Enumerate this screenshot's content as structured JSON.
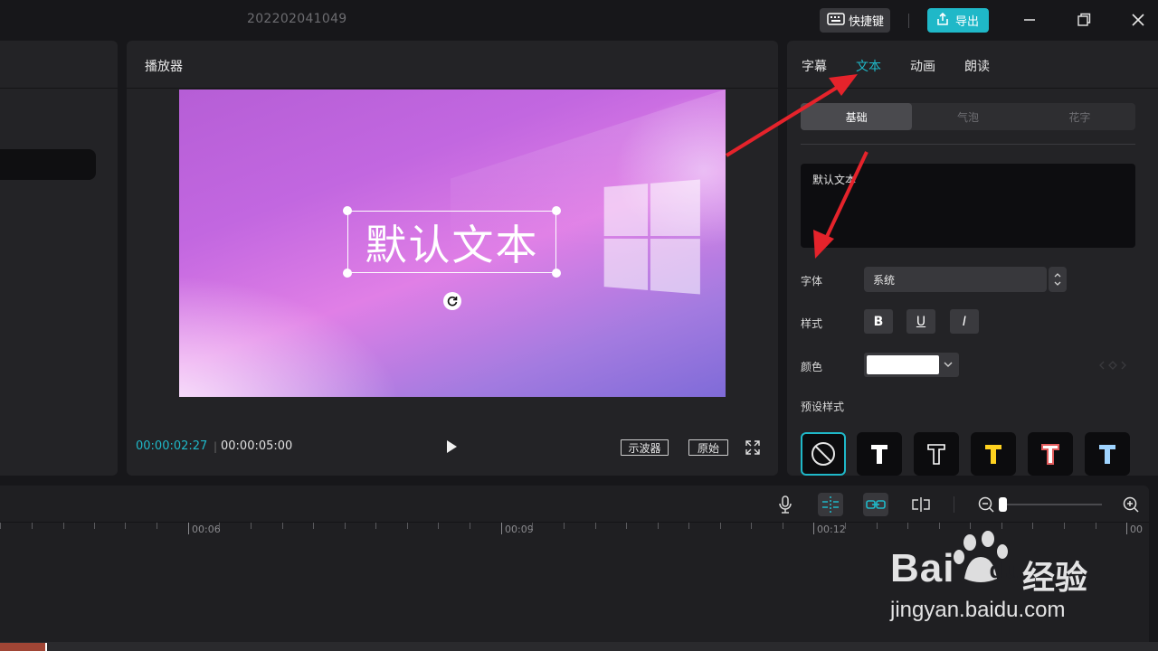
{
  "titlebar": {
    "title": "202202041049",
    "shortcut_label": "快捷键",
    "export_label": "导出"
  },
  "player": {
    "title": "播放器",
    "overlay_text": "默认文本",
    "time_current": "00:00:02:27",
    "time_separator": "|",
    "time_total": "00:00:05:00",
    "scope_label": "示波器",
    "original_label": "原始"
  },
  "right_panel": {
    "tabs": [
      "字幕",
      "文本",
      "动画",
      "朗读"
    ],
    "active_tab": "文本",
    "subtabs": [
      "基础",
      "气泡",
      "花字"
    ],
    "text_value": "默认文本",
    "font_label": "字体",
    "font_value": "系统",
    "style_label": "样式",
    "style_buttons": [
      "B",
      "U",
      "I"
    ],
    "color_label": "颜色",
    "color_value": "#ffffff",
    "preset_label": "预设样式",
    "preset_colors": [
      "#ffffff",
      "#ffffff",
      "#ffd21f",
      "#ff8f8f",
      "#9fd4ff"
    ]
  },
  "timeline": {
    "ticks": [
      "00:06",
      "00:09",
      "00:12",
      "00"
    ]
  },
  "watermark": {
    "brand": "Bai",
    "brand_du": "du",
    "brand_cn": "经验",
    "url": "jingyan.baidu.com"
  },
  "colors": {
    "accent": "#1fb8c8",
    "arrow": "#e5232b"
  }
}
